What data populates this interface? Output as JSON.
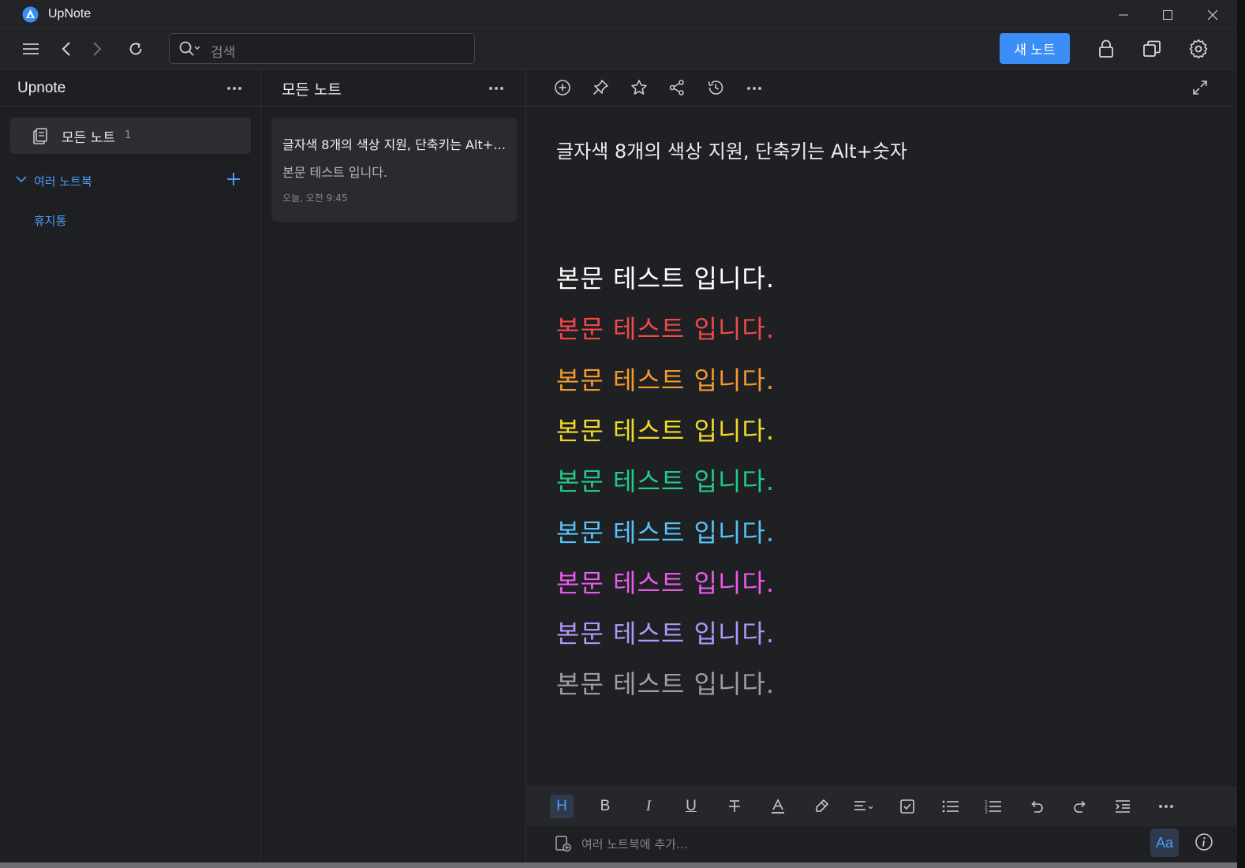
{
  "window": {
    "app_title": "UpNote"
  },
  "toolbar": {
    "search_placeholder": "검색",
    "new_note_label": "새 노트"
  },
  "sidebar": {
    "title": "Upnote",
    "all_notes_label": "모든 노트",
    "all_notes_count": "1",
    "notebooks_label": "여러 노트북",
    "trash_label": "휴지통"
  },
  "notelist": {
    "title": "모든 노트",
    "notes": [
      {
        "title": "글자색 8개의 색상 지원, 단축키는 Alt+숫자",
        "preview": "본문 테스트 입니다.",
        "date": "오늘, 오전 9:45"
      }
    ]
  },
  "editor": {
    "title": "글자색 8개의 색상 지원, 단축키는 Alt+숫자",
    "lines": [
      {
        "text": "본문 테스트 입니다.",
        "color": "#ffffff"
      },
      {
        "text": "본문 테스트 입니다.",
        "color": "#f0494a"
      },
      {
        "text": "본문 테스트 입니다.",
        "color": "#f29a2e"
      },
      {
        "text": "본문 테스트 입니다.",
        "color": "#f0da28"
      },
      {
        "text": "본문 테스트 입니다.",
        "color": "#23c98a"
      },
      {
        "text": "본문 테스트 입니다.",
        "color": "#56c2f5"
      },
      {
        "text": "본문 테스트 입니다.",
        "color": "#ea5ae8"
      },
      {
        "text": "본문 테스트 입니다.",
        "color": "#b196f7"
      },
      {
        "text": "본문 테스트 입니다.",
        "color": "#9d9ea2"
      }
    ],
    "format_heading_label": "H",
    "format_bold_label": "B",
    "format_italic_label": "I",
    "format_underline_label": "U",
    "footer_notebook_label": "여러 노트북에 추가...",
    "font_button_label": "Aa"
  },
  "colors": {
    "accent": "#3a8ef5",
    "link": "#4e9bf7",
    "background": "#1f2023"
  }
}
